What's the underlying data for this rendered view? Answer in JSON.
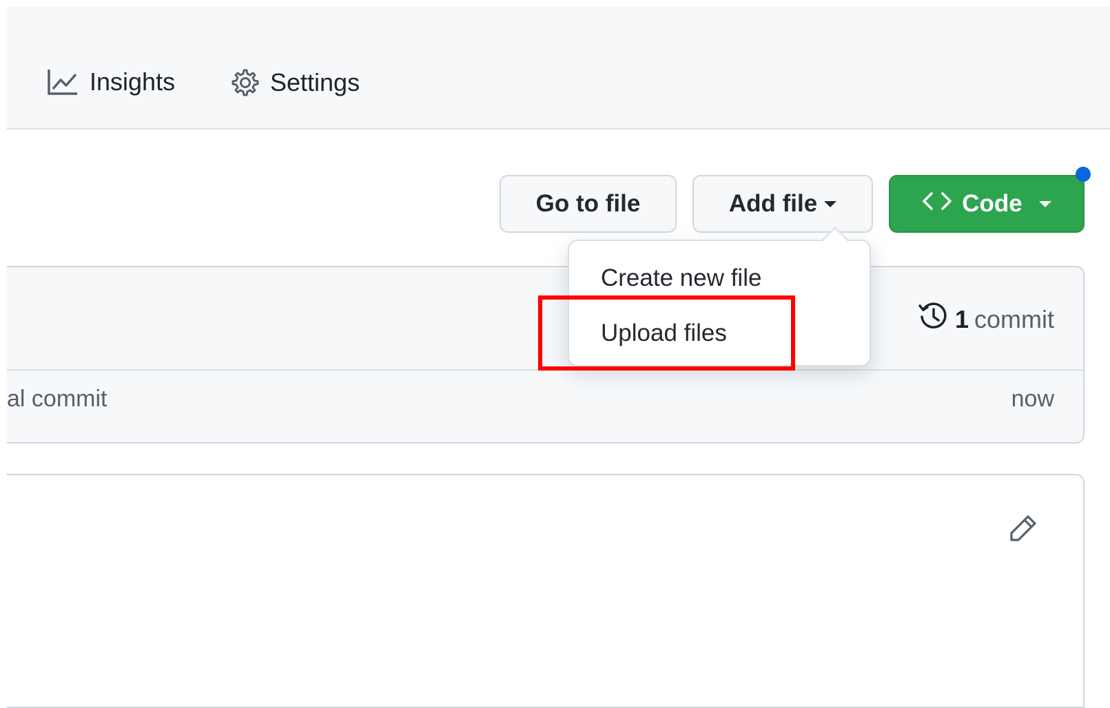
{
  "nav": {
    "items": [
      {
        "label": "Insights",
        "icon": "graph-icon"
      },
      {
        "label": "Settings",
        "icon": "gear-icon"
      }
    ]
  },
  "toolbar": {
    "goto_label": "Go to file",
    "addfile_label": "Add file",
    "code_label": "Code"
  },
  "dropdown": {
    "items": [
      {
        "label": "Create new file"
      },
      {
        "label": "Upload files"
      }
    ]
  },
  "repo": {
    "partial_char": "/",
    "commit_count": "1",
    "commit_word": "commit",
    "last_commit_message": "al commit",
    "last_commit_time": "now"
  },
  "colors": {
    "primary_green": "#2da44e",
    "highlight_red": "#ff0000",
    "notification_blue": "#0969da"
  }
}
